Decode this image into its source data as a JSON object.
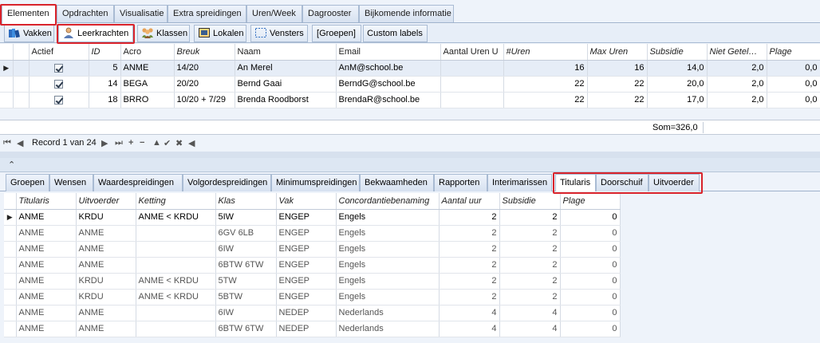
{
  "top_tabs": [
    "Elementen",
    "Opdrachten",
    "Visualisatie",
    "Extra spreidingen",
    "Uren/Week",
    "Dagrooster",
    "Bijkomende informatie"
  ],
  "sub_tabs": [
    {
      "label": "Vakken",
      "icon": "books-icon"
    },
    {
      "label": "Leerkrachten",
      "icon": "teacher-icon"
    },
    {
      "label": "Klassen",
      "icon": "group-icon"
    },
    {
      "label": "Lokalen",
      "icon": "room-icon"
    },
    {
      "label": "Vensters",
      "icon": "window-icon"
    },
    {
      "label": "[Groepen]",
      "icon": ""
    },
    {
      "label": "Custom labels",
      "icon": ""
    }
  ],
  "teachers": {
    "columns": [
      "Actief",
      "ID",
      "Acro",
      "Breuk",
      "Naam",
      "Email",
      "Aantal Uren U",
      "#Uren",
      "Max Uren",
      "Subsidie",
      "Niet Getel…",
      "Plage"
    ],
    "rows": [
      {
        "actief": true,
        "id": "5",
        "acro": "ANME",
        "breuk": "14/20",
        "naam": "An Merel",
        "email": "AnM@school.be",
        "aantal": "",
        "uren": "16",
        "max": "16",
        "subsidie": "14,0",
        "niet": "2,0",
        "plage": "0,0"
      },
      {
        "actief": true,
        "id": "14",
        "acro": "BEGA",
        "breuk": "20/20",
        "naam": "Bernd Gaai",
        "email": "BerndG@school.be",
        "aantal": "",
        "uren": "22",
        "max": "22",
        "subsidie": "20,0",
        "niet": "2,0",
        "plage": "0,0"
      },
      {
        "actief": true,
        "id": "18",
        "acro": "BRRO",
        "breuk": "10/20 + 7/29",
        "naam": "Brenda Roodborst",
        "email": "BrendaR@school.be",
        "aantal": "",
        "uren": "22",
        "max": "22",
        "subsidie": "17,0",
        "niet": "2,0",
        "plage": "0,0"
      }
    ],
    "sum": "Som=326,0"
  },
  "navigator": {
    "record": "Record 1 van 24"
  },
  "bottom_tabs": [
    "Groepen",
    "Wensen",
    "Waardespreidingen",
    "Volgordespreidingen",
    "Minimumspreidingen",
    "Bekwaamheden",
    "Rapporten",
    "Interimarissen",
    "Titularis",
    "Doorschuif",
    "Uitvoerder"
  ],
  "assignments": {
    "columns": [
      "Titularis",
      "Uitvoerder",
      "Ketting",
      "Klas",
      "Vak",
      "Concordantiebenaming",
      "Aantal uur",
      "Subsidie",
      "Plage"
    ],
    "rows": [
      {
        "titularis": "ANME",
        "uitvoerder": "KRDU",
        "ketting": "ANME < KRDU",
        "klas": "5IW",
        "vak": "ENGEP",
        "conc": "Engels",
        "uur": "2",
        "sub": "2",
        "plage": "0"
      },
      {
        "titularis": "ANME",
        "uitvoerder": "ANME",
        "ketting": "",
        "klas": "6GV 6LB",
        "vak": "ENGEP",
        "conc": "Engels",
        "uur": "2",
        "sub": "2",
        "plage": "0"
      },
      {
        "titularis": "ANME",
        "uitvoerder": "ANME",
        "ketting": "",
        "klas": "6IW",
        "vak": "ENGEP",
        "conc": "Engels",
        "uur": "2",
        "sub": "2",
        "plage": "0"
      },
      {
        "titularis": "ANME",
        "uitvoerder": "ANME",
        "ketting": "",
        "klas": "6BTW 6TW",
        "vak": "ENGEP",
        "conc": "Engels",
        "uur": "2",
        "sub": "2",
        "plage": "0"
      },
      {
        "titularis": "ANME",
        "uitvoerder": "KRDU",
        "ketting": "ANME < KRDU",
        "klas": "5TW",
        "vak": "ENGEP",
        "conc": "Engels",
        "uur": "2",
        "sub": "2",
        "plage": "0"
      },
      {
        "titularis": "ANME",
        "uitvoerder": "KRDU",
        "ketting": "ANME < KRDU",
        "klas": "5BTW",
        "vak": "ENGEP",
        "conc": "Engels",
        "uur": "2",
        "sub": "2",
        "plage": "0"
      },
      {
        "titularis": "ANME",
        "uitvoerder": "ANME",
        "ketting": "",
        "klas": "6IW",
        "vak": "NEDEP",
        "conc": "Nederlands",
        "uur": "4",
        "sub": "4",
        "plage": "0"
      },
      {
        "titularis": "ANME",
        "uitvoerder": "ANME",
        "ketting": "",
        "klas": "6BTW 6TW",
        "vak": "NEDEP",
        "conc": "Nederlands",
        "uur": "4",
        "sub": "4",
        "plage": "0"
      }
    ]
  },
  "colors": {
    "highlight": "#d9232b",
    "selected_row": "#e6edf7",
    "tab_border": "#a9bbd3"
  }
}
